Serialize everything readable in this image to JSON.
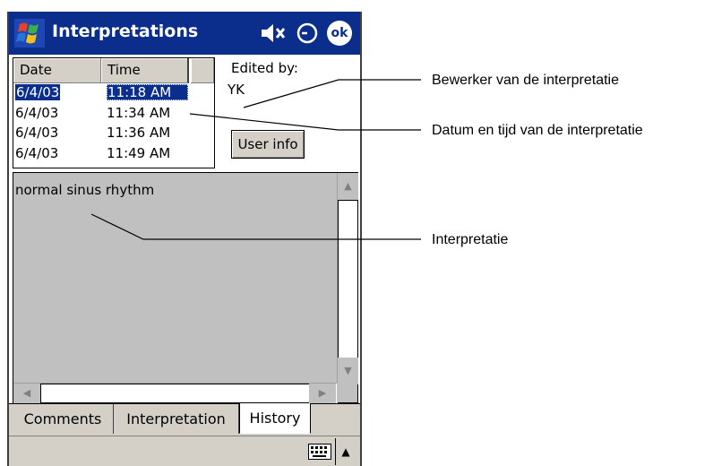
{
  "window": {
    "title": "Interpretations",
    "ok_label": "ok",
    "title_bar_color": "#0b2d8c"
  },
  "status_icons": [
    "volume-muted-icon",
    "clock-icon"
  ],
  "history_list": {
    "columns": [
      "Date",
      "Time",
      ""
    ],
    "rows": [
      {
        "date": "6/4/03",
        "time": "11:18 AM",
        "selected": true
      },
      {
        "date": "6/4/03",
        "time": "11:34 AM",
        "selected": false
      },
      {
        "date": "6/4/03",
        "time": "11:36 AM",
        "selected": false
      },
      {
        "date": "6/4/03",
        "time": "11:49 AM",
        "selected": false
      }
    ]
  },
  "editor": {
    "label": "Edited by:",
    "value": "YK",
    "user_info_button": "User info"
  },
  "interpretation": {
    "text": "normal sinus rhythm"
  },
  "tabs": [
    {
      "label": "Comments",
      "active": false
    },
    {
      "label": "Interpretation",
      "active": false
    },
    {
      "label": "History",
      "active": true
    }
  ],
  "annotations": {
    "editor": "Bewerker van de interpretatie",
    "datetime": "Datum en tijd van de interpretatie",
    "interpretation": "Interpretatie"
  }
}
